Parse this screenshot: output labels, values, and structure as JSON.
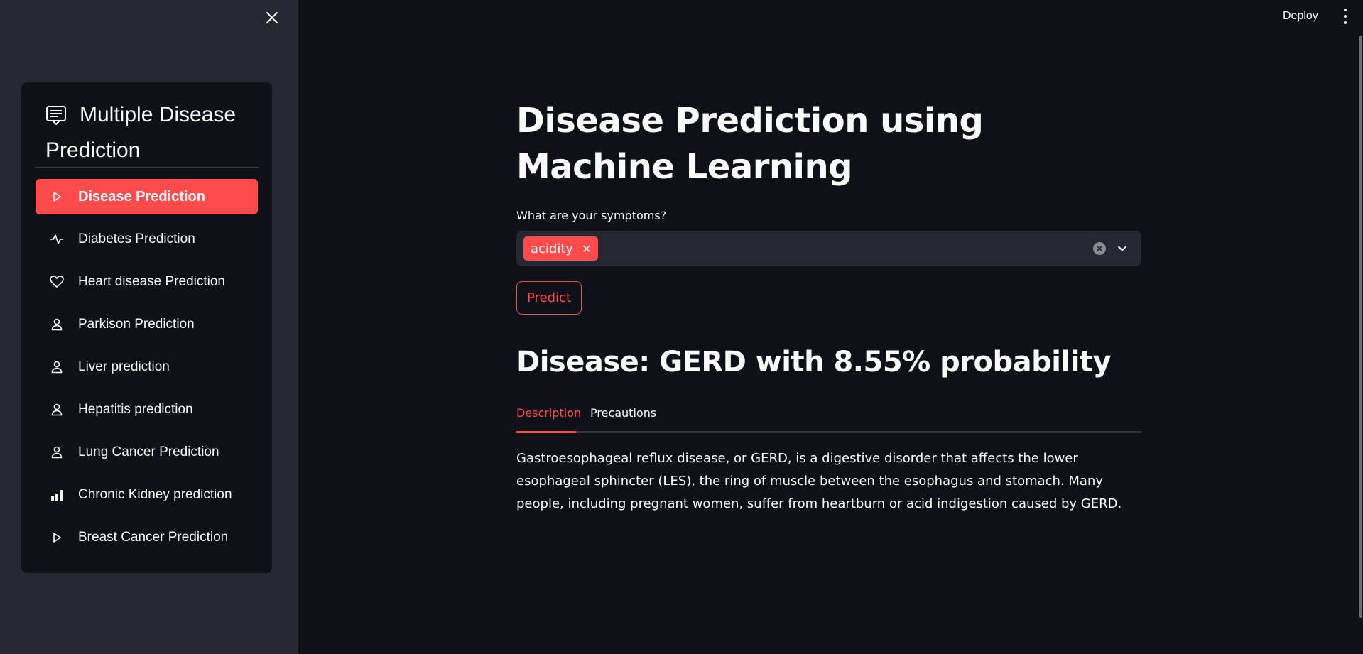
{
  "sidebar": {
    "menu_title": "Multiple Disease Prediction",
    "items": [
      {
        "label": "Disease Prediction",
        "icon": "play-icon",
        "active": true
      },
      {
        "label": "Diabetes Prediction",
        "icon": "activity-icon",
        "active": false
      },
      {
        "label": "Heart disease Prediction",
        "icon": "heart-icon",
        "active": false
      },
      {
        "label": "Parkison Prediction",
        "icon": "person-icon",
        "active": false
      },
      {
        "label": "Liver prediction",
        "icon": "person-icon",
        "active": false
      },
      {
        "label": "Hepatitis prediction",
        "icon": "person-icon",
        "active": false
      },
      {
        "label": "Lung Cancer Prediction",
        "icon": "person-icon",
        "active": false
      },
      {
        "label": "Chronic Kidney prediction",
        "icon": "bar-chart-icon",
        "active": false
      },
      {
        "label": "Breast Cancer Prediction",
        "icon": "play-icon",
        "active": false
      }
    ]
  },
  "toolbar": {
    "deploy_label": "Deploy"
  },
  "main": {
    "title": "Disease Prediction using Machine Learning",
    "symptoms_label": "What are your symptoms?",
    "selected_symptoms": [
      "acidity"
    ],
    "predict_label": "Predict",
    "result_heading": "Disease: GERD with 8.55% probability",
    "tabs": [
      {
        "label": "Description",
        "active": true
      },
      {
        "label": "Precautions",
        "active": false
      }
    ],
    "description": "Gastroesophageal reflux disease, or GERD, is a digestive disorder that affects the lower esophageal sphincter (LES), the ring of muscle between the esophagus and stomach. Many people, including pregnant women, suffer from heartburn or acid indigestion caused by GERD."
  },
  "colors": {
    "accent": "#ff4b4b",
    "background": "#0e1117",
    "sidebar": "#262730"
  }
}
